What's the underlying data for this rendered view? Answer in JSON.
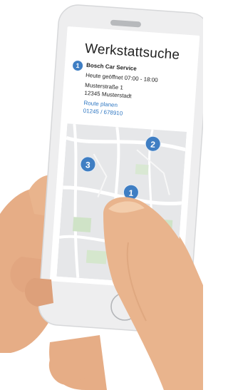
{
  "screen": {
    "title": "Werkstattsuche",
    "result": {
      "number": "1",
      "name": "Bosch Car Service",
      "hours": "Heute geöffnet 07:00 - 18:00",
      "street": "Musterstraße 1",
      "city": "12345 Musterstadt",
      "route_link": "Route planen",
      "phone": "01245 / 678910"
    },
    "map_pins": [
      "1",
      "2",
      "3"
    ]
  },
  "colors": {
    "accent": "#3f7ec3",
    "link": "#2f77c2",
    "skin": "#e9b48d"
  }
}
